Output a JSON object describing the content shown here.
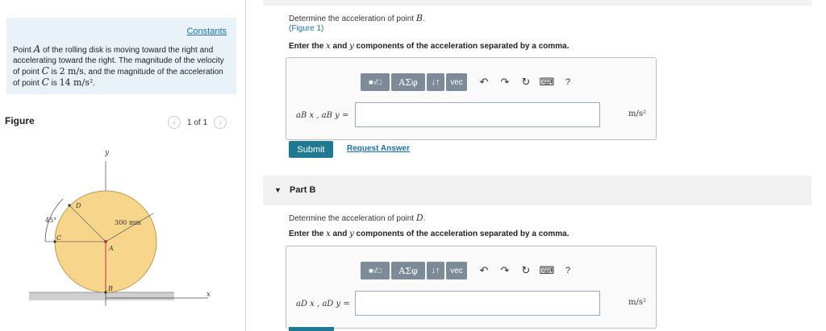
{
  "left": {
    "constants_link": "Constants",
    "problem": {
      "pre_a": "Point ",
      "point_a": "A",
      "mid1": " of the rolling disk is moving toward the right and accelerating toward the right. The magnitude of the velocity of point ",
      "point_c": "C",
      "mid2": " is ",
      "vel": "2 m/s",
      "mid3": ", and the magnitude of the acceleration of point ",
      "point_c2": "C",
      "mid4": " is ",
      "acc": "14 m/s²",
      "end": "."
    },
    "figure_label": "Figure",
    "pager": {
      "prev": "‹",
      "text": "1 of 1",
      "next": "›"
    },
    "figure": {
      "y_axis": "y",
      "x_axis": "x",
      "angle": "45°",
      "radius": "300 mm",
      "point_a": "A",
      "point_b": "B",
      "point_c": "C",
      "point_d": "D",
      "colors": {
        "disk": "#f7d58a",
        "disk_edge": "#b89a55",
        "ground": "#cfcfcf",
        "vector": "#c0304a"
      }
    }
  },
  "partA": {
    "question_pre": "Determine the acceleration of point ",
    "question_point": "B",
    "question_end": ".",
    "figure_link": "(Figure 1)",
    "instr_pre": "Enter the ",
    "instr_x": "x",
    "instr_mid": " and ",
    "instr_y": "y",
    "instr_end": " components of the acceleration separated by a comma.",
    "toolbar": {
      "templates": "■√□",
      "greek": "ΑΣφ",
      "arrows": "↓↑",
      "vec": "vec",
      "undo": "↶",
      "redo": "↷",
      "reset": "↻",
      "keyboard": "⌨",
      "help": "?"
    },
    "var_label": "aB x , aB y =",
    "unit": "m/s²",
    "submit": "Submit",
    "request": "Request Answer"
  },
  "partB": {
    "arrow": "▼",
    "title": "Part B",
    "question_pre": "Determine the acceleration of point ",
    "question_point": "D",
    "question_end": ".",
    "instr_pre": "Enter the ",
    "instr_x": "x",
    "instr_mid": " and ",
    "instr_y": "y",
    "instr_end": " components of the acceleration separated by a comma.",
    "toolbar": {
      "templates": "■√□",
      "greek": "ΑΣφ",
      "arrows": "↓↑",
      "vec": "vec",
      "undo": "↶",
      "redo": "↷",
      "reset": "↻",
      "keyboard": "⌨",
      "help": "?"
    },
    "var_label": "aD x , aD y =",
    "unit": "m/s²"
  }
}
